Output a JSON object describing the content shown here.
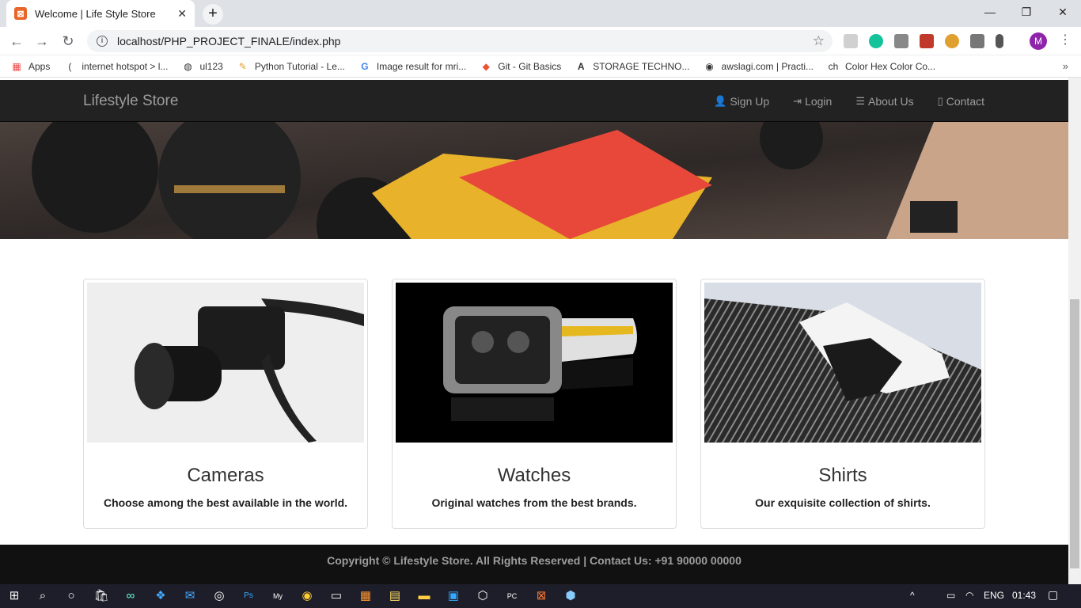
{
  "browser": {
    "tab_title": "Welcome | Life Style Store",
    "url": "localhost/PHP_PROJECT_FINALE/index.php",
    "avatar_letter": "M",
    "bookmarks": [
      "Apps",
      "internet hotspot > l...",
      "ul123",
      "Python Tutorial - Le...",
      "Image result for mri...",
      "Git - Git Basics",
      "STORAGE TECHNO...",
      "awslagi.com | Practi...",
      "Color Hex Color Co..."
    ]
  },
  "site": {
    "brand": "Lifestyle Store",
    "nav": [
      "Sign Up",
      "Login",
      "About Us",
      "Contact"
    ],
    "cards": [
      {
        "title": "Cameras",
        "desc": "Choose among the best available in the world."
      },
      {
        "title": "Watches",
        "desc": "Original watches from the best brands."
      },
      {
        "title": "Shirts",
        "desc": "Our exquisite collection of shirts."
      }
    ],
    "footer": "Copyright © Lifestyle Store. All Rights Reserved | Contact Us: +91 90000 00000"
  },
  "taskbar": {
    "lang": "ENG",
    "time": "01:43"
  }
}
